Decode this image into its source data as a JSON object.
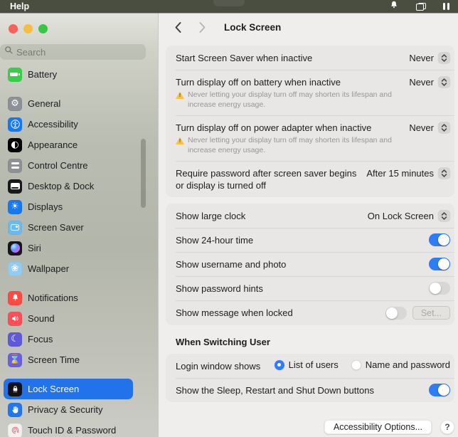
{
  "menubar": {
    "help_label": "Help"
  },
  "sidebar": {
    "search_placeholder": "Search",
    "groups": [
      [
        {
          "label": "Battery",
          "icon": "battery-icon",
          "color": "#37cf4a"
        }
      ],
      [
        {
          "label": "General",
          "icon": "general-icon",
          "color": "#8d9095"
        },
        {
          "label": "Accessibility",
          "icon": "accessibility-icon",
          "color": "#1779f2"
        },
        {
          "label": "Appearance",
          "icon": "appearance-icon",
          "color": "#000000"
        },
        {
          "label": "Control Centre",
          "icon": "control-centre-icon",
          "color": "#8d9095"
        },
        {
          "label": "Desktop & Dock",
          "icon": "desktop-dock-icon",
          "color": "#19191b"
        },
        {
          "label": "Displays",
          "icon": "displays-icon",
          "color": "#1779f2"
        },
        {
          "label": "Screen Saver",
          "icon": "screen-saver-icon",
          "color": "#6db9ee"
        },
        {
          "label": "Siri",
          "icon": "siri-icon",
          "color": "#17171a"
        },
        {
          "label": "Wallpaper",
          "icon": "wallpaper-icon",
          "color": "#8fcdf4"
        }
      ],
      [
        {
          "label": "Notifications",
          "icon": "notifications-icon",
          "color": "#fb4b43"
        },
        {
          "label": "Sound",
          "icon": "sound-icon",
          "color": "#fa4f57"
        },
        {
          "label": "Focus",
          "icon": "focus-icon",
          "color": "#5d59d8"
        },
        {
          "label": "Screen Time",
          "icon": "screen-time-icon",
          "color": "#6761e0"
        }
      ],
      [
        {
          "label": "Lock Screen",
          "icon": "lock-icon",
          "color": "#121214",
          "selected": true
        },
        {
          "label": "Privacy & Security",
          "icon": "privacy-icon",
          "color": "#2277f1"
        },
        {
          "label": "Touch ID & Password",
          "icon": "touch-id-icon",
          "color": "#f3f1f0"
        }
      ]
    ]
  },
  "icon_glyphs": {
    "general-icon": "⚙",
    "appearance-icon": "◐",
    "displays-icon": "☀",
    "focus-icon": "☾",
    "screen-time-icon": "⌛",
    "wallpaper-icon": "❀"
  },
  "header": {
    "title": "Lock Screen"
  },
  "content": {
    "groups": [
      {
        "rows": [
          {
            "type": "dropdown",
            "label": "Start Screen Saver when inactive",
            "value": "Never"
          },
          {
            "type": "dropdown",
            "label": "Turn display off on battery when inactive",
            "value": "Never",
            "warning": "Never letting your display turn off may shorten its lifespan and increase energy usage."
          },
          {
            "type": "dropdown",
            "label": "Turn display off on power adapter when inactive",
            "value": "Never",
            "warning": "Never letting your display turn off may shorten its lifespan and increase energy usage."
          },
          {
            "type": "dropdown",
            "label": "Require password after screen saver begins or display is turned off",
            "value": "After 15 minutes"
          }
        ]
      },
      {
        "rows": [
          {
            "type": "dropdown",
            "label": "Show large clock",
            "value": "On Lock Screen"
          },
          {
            "type": "toggle",
            "label": "Show 24-hour time",
            "on": true
          },
          {
            "type": "toggle",
            "label": "Show username and photo",
            "on": true
          },
          {
            "type": "toggle",
            "label": "Show password hints",
            "on": false
          },
          {
            "type": "toggle_button",
            "label": "Show message when locked",
            "on": false,
            "button": "Set..."
          }
        ]
      },
      {
        "section": "When Switching User",
        "rows": [
          {
            "type": "radio_group",
            "label": "Login window shows",
            "options": [
              {
                "label": "List of users",
                "selected": true
              },
              {
                "label": "Name and password",
                "selected": false
              }
            ]
          },
          {
            "type": "toggle",
            "label": "Show the Sleep, Restart and Shut Down buttons",
            "on": true
          }
        ]
      }
    ]
  },
  "footer": {
    "accessibility_button": "Accessibility Options...",
    "help_label": "?"
  },
  "colors": {
    "accent": "#2e7cf6",
    "sidebar_selected": "#2273eb",
    "menubar_bg": "#4a4e41",
    "warning": "#f6c244",
    "close": "#f5615c",
    "minimize": "#f6bd3f",
    "zoom_btn": "#3ac545"
  }
}
